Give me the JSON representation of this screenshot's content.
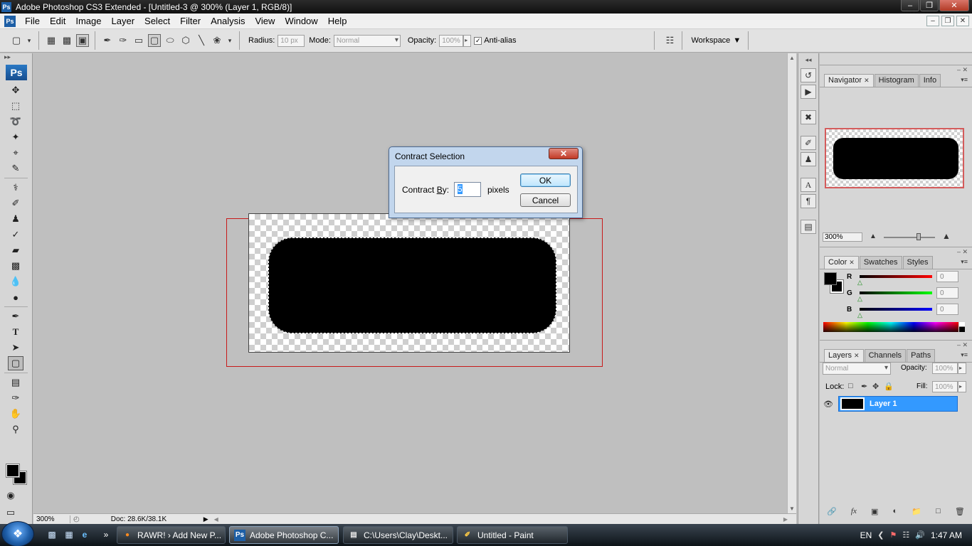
{
  "window": {
    "title": "Adobe Photoshop CS3 Extended - [Untitled-3 @ 300% (Layer 1, RGB/8)]",
    "app_icon": "Ps"
  },
  "menubar": {
    "items": [
      "File",
      "Edit",
      "Image",
      "Layer",
      "Select",
      "Filter",
      "Analysis",
      "View",
      "Window",
      "Help"
    ]
  },
  "options": {
    "radius_label": "Radius:",
    "radius_value": "10 px",
    "mode_label": "Mode:",
    "mode_value": "Normal",
    "opacity_label": "Opacity:",
    "opacity_value": "100%",
    "antialias_label": "Anti-alias",
    "antialias_checked": true,
    "workspace_label": "Workspace"
  },
  "tools": {
    "logo": "Ps",
    "items": [
      "move-tool",
      "marquee-tool",
      "lasso-tool",
      "magic-wand-tool",
      "crop-tool",
      "slice-tool",
      "healing-brush-tool",
      "brush-tool",
      "clone-stamp-tool",
      "history-brush-tool",
      "eraser-tool",
      "gradient-tool",
      "blur-tool",
      "dodge-tool",
      "pen-tool",
      "type-tool",
      "path-selection-tool",
      "rounded-rectangle-tool",
      "notes-tool",
      "eyedropper-tool",
      "hand-tool",
      "zoom-tool"
    ],
    "selected": "rounded-rectangle-tool",
    "foreground_color": "#000000",
    "background_color": "#000000"
  },
  "status": {
    "zoom": "300%",
    "doc": "Doc: 28.6K/38.1K"
  },
  "dialog": {
    "title": "Contract Selection",
    "label_prefix": "Contract ",
    "label_underlined": "B",
    "label_suffix": "y:",
    "value": "5",
    "unit": "pixels",
    "ok_label": "OK",
    "cancel_label": "Cancel"
  },
  "navigator": {
    "tabs": [
      "Navigator",
      "Histogram",
      "Info"
    ],
    "zoom": "300%"
  },
  "color_panel": {
    "tabs": [
      "Color",
      "Swatches",
      "Styles"
    ],
    "channels": [
      {
        "label": "R",
        "value": "0",
        "color": "#cc0000"
      },
      {
        "label": "G",
        "value": "0",
        "color": "#00b300"
      },
      {
        "label": "B",
        "value": "0",
        "color": "#0000cc"
      }
    ]
  },
  "layers_panel": {
    "tabs": [
      "Layers",
      "Channels",
      "Paths"
    ],
    "blend_mode": "Normal",
    "opacity_label": "Opacity:",
    "opacity_value": "100%",
    "lock_label": "Lock:",
    "fill_label": "Fill:",
    "fill_value": "100%",
    "layers": [
      {
        "name": "Layer 1",
        "visible": true,
        "selected": true
      }
    ]
  },
  "taskbar": {
    "tasks": [
      {
        "label": "RAWR! › Add New P...",
        "icon": "firefox-icon",
        "active": false
      },
      {
        "label": "Adobe Photoshop C...",
        "icon": "photoshop-icon",
        "active": true
      },
      {
        "label": "C:\\Users\\Clay\\Deskt...",
        "icon": "notepad-icon",
        "active": false
      },
      {
        "label": "Untitled - Paint",
        "icon": "paint-icon",
        "active": false
      }
    ],
    "language": "EN",
    "time": "1:47 AM"
  },
  "colors": {
    "accent_selected_layer": "#3399ff",
    "dialog_frame": "#c2d6ed",
    "canvas_bg": "#bfbfbf"
  }
}
